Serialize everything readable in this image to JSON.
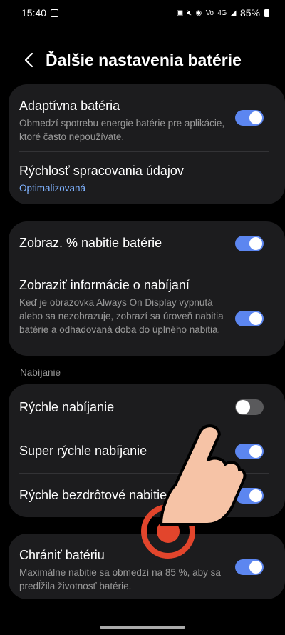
{
  "status_bar": {
    "time": "15:40",
    "battery_text": "85%",
    "signal_label_1": "Vo)\nLTE1",
    "signal_label_2": "4G"
  },
  "header": {
    "title": "Ďalšie nastavenia batérie",
    "back_icon": "chevron-left-icon"
  },
  "group1": {
    "adaptive": {
      "title": "Adaptívna batéria",
      "description": "Obmedzí spotrebu energie batérie pre aplikácie, ktoré často nepoužívate.",
      "enabled": true
    },
    "processing": {
      "title": "Rýchlosť spracovania údajov",
      "value": "Optimalizovaná"
    }
  },
  "group2": {
    "percent": {
      "title": "Zobraz. % nabitie batérie",
      "enabled": true
    },
    "charging_info": {
      "title": "Zobraziť informácie o nabíjaní",
      "description": "Keď je obrazovka Always On Display vypnutá alebo sa nezobrazuje, zobrazí sa úroveň nabitia batérie a odhadovaná doba do úplného nabitia.",
      "enabled": true
    }
  },
  "charging_section": {
    "label": "Nabíjanie",
    "fast": {
      "title": "Rýchle nabíjanie",
      "enabled": false
    },
    "super_fast": {
      "title": "Super rýchle nabíjanie",
      "enabled": true
    },
    "wireless": {
      "title": "Rýchle bezdrôtové nabitie",
      "enabled": true
    }
  },
  "group4": {
    "protect": {
      "title": "Chrániť batériu",
      "description": "Maximálne nabitie sa obmedzí na 85 %, aby sa predĺžila životnosť batérie.",
      "enabled": true
    }
  },
  "colors": {
    "toggle_on": "#5c86f0",
    "toggle_off": "#5a5a5c",
    "link": "#7fb2ff",
    "card_bg": "#1c1c1e"
  }
}
